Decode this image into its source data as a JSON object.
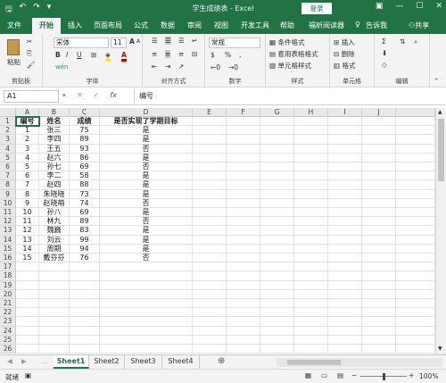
{
  "window": {
    "title": "学生成绩表 - Excel",
    "sign_in": "登录",
    "share": "共享",
    "tell_me": "告诉我"
  },
  "tabs": [
    "文件",
    "开始",
    "插入",
    "页面布局",
    "公式",
    "数据",
    "审阅",
    "视图",
    "开发工具",
    "帮助",
    "福昕阅读器"
  ],
  "active_tab": "开始",
  "ribbon": {
    "clipboard": {
      "label": "剪贴板",
      "paste": "粘贴"
    },
    "font": {
      "label": "字体",
      "font_name": "宋体",
      "font_size": "11",
      "bold": "B",
      "italic": "I",
      "underline": "U",
      "grow": "A",
      "shrink": "A",
      "font_color": "A",
      "fill": "wén"
    },
    "alignment": {
      "label": "对齐方式"
    },
    "number": {
      "label": "数字",
      "format": "常规",
      "percent": "%",
      "comma": ","
    },
    "styles": {
      "label": "样式",
      "conditional": "条件格式",
      "table": "套用表格格式",
      "cell": "单元格样式"
    },
    "cells": {
      "label": "单元格",
      "insert": "插入",
      "delete": "删除",
      "format": "格式"
    },
    "editing": {
      "label": "编辑",
      "sum": "Σ"
    }
  },
  "formula_bar": {
    "name_box": "A1",
    "fx": "fx",
    "content": "编号"
  },
  "columns": [
    "A",
    "B",
    "C",
    "D",
    "E",
    "F",
    "G",
    "H",
    "I",
    "J"
  ],
  "rows": [
    "1",
    "2",
    "3",
    "4",
    "5",
    "6",
    "7",
    "8",
    "9",
    "10",
    "11",
    "12",
    "13",
    "14",
    "15",
    "16",
    "17",
    "18",
    "19",
    "20",
    "21",
    "22",
    "23",
    "24",
    "25",
    "26"
  ],
  "table": {
    "headers": [
      "编号",
      "姓名",
      "成绩",
      "是否实现了学期目标"
    ],
    "rows": [
      [
        "1",
        "张三",
        "75",
        "是"
      ],
      [
        "2",
        "李四",
        "89",
        "是"
      ],
      [
        "3",
        "王五",
        "93",
        "否"
      ],
      [
        "4",
        "赵六",
        "86",
        "是"
      ],
      [
        "5",
        "孙七",
        "69",
        "否"
      ],
      [
        "6",
        "李二",
        "58",
        "是"
      ],
      [
        "7",
        "赵四",
        "88",
        "是"
      ],
      [
        "8",
        "朱晓晓",
        "73",
        "是"
      ],
      [
        "9",
        "赵晓萌",
        "74",
        "否"
      ],
      [
        "10",
        "孙八",
        "69",
        "是"
      ],
      [
        "11",
        "林九",
        "89",
        "否"
      ],
      [
        "12",
        "魏巍",
        "83",
        "是"
      ],
      [
        "13",
        "刘云",
        "99",
        "是"
      ],
      [
        "14",
        "周期",
        "94",
        "是"
      ],
      [
        "15",
        "戴芬芬",
        "76",
        "否"
      ]
    ]
  },
  "sheets": [
    "Sheet1",
    "Sheet2",
    "Sheet3",
    "Sheet4"
  ],
  "active_sheet": "Sheet1",
  "status": {
    "ready": "就绪",
    "zoom": "100%"
  }
}
